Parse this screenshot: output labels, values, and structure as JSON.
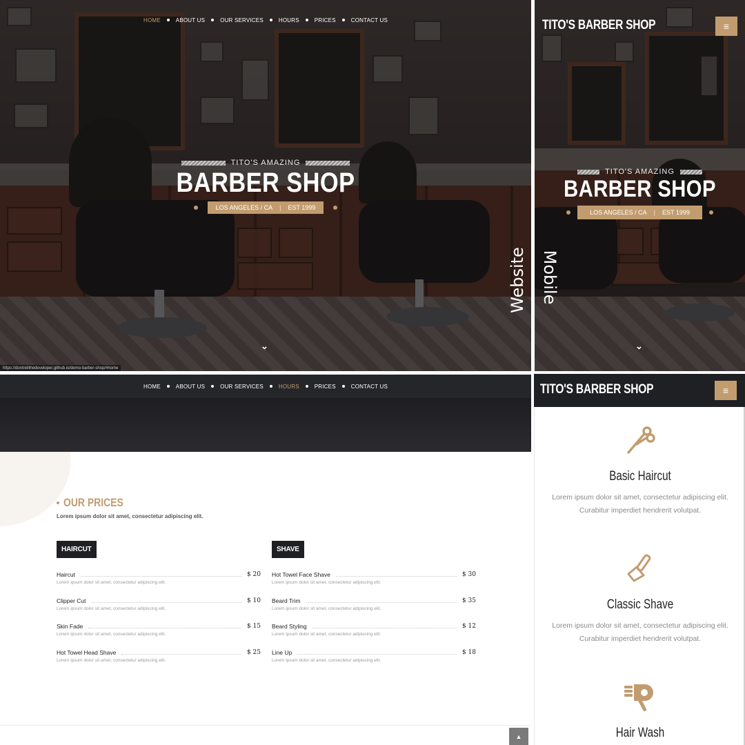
{
  "desktop": {
    "nav": [
      "HOME",
      "ABOUT US",
      "OUR SERVICES",
      "HOURS",
      "PRICES",
      "CONTACT US"
    ],
    "nav_active": "HOME",
    "hero_subtitle": "TITO'S AMAZING",
    "hero_title": "BARBER SHOP",
    "hero_location": "LOS ANGELES / CA",
    "hero_est": "EST 1999",
    "status_url": "https://dontrelithedeveloper.github.io/demo-barber-shop/#home"
  },
  "labels": {
    "website": "Website",
    "mobile": "Mobile"
  },
  "mobile": {
    "brand": "TITO'S BARBER SHOP",
    "menu_icon": "hamburger-icon",
    "hero_subtitle": "TITO'S AMAZING",
    "hero_title": "BARBER SHOP",
    "hero_location": "LOS ANGELES / CA",
    "hero_est": "EST 1999"
  },
  "prices_page": {
    "nav": [
      "HOME",
      "ABOUT US",
      "OUR SERVICES",
      "HOURS",
      "PRICES",
      "CONTACT US"
    ],
    "nav_active": "HOURS",
    "heading": "OUR PRICES",
    "subtitle": "Lorem ipsum dolor sit amet, consectetur adipiscing elit.",
    "categories": [
      {
        "name": "HAIRCUT",
        "items": [
          {
            "name": "Haircut",
            "price": "$ 20",
            "desc": "Lorem ipsum dolor sit amet, consectetur adipiscing elit."
          },
          {
            "name": "Clipper Cut",
            "price": "$ 10",
            "desc": "Lorem ipsum dolor sit amet, consectetur adipiscing elit."
          },
          {
            "name": "Skin Fade",
            "price": "$ 15",
            "desc": "Lorem ipsum dolor sit amet, consectetur adipiscing elit."
          },
          {
            "name": "Hot Towel Head Shave",
            "price": "$ 25",
            "desc": "Lorem ipsum dolor sit amet, consectetur adipiscing elit."
          }
        ]
      },
      {
        "name": "SHAVE",
        "items": [
          {
            "name": "Hot Towel Face Shave",
            "price": "$ 30",
            "desc": "Lorem ipsum dolor sit amet, consectetur adipiscing elit."
          },
          {
            "name": "Beard Trim",
            "price": "$ 35",
            "desc": "Lorem ipsum dolor sit amet, consectetur adipiscing elit."
          },
          {
            "name": "Beard Styling",
            "price": "$ 12",
            "desc": "Lorem ipsum dolor sit amet, consectetur adipiscing elit."
          },
          {
            "name": "Line Up",
            "price": "$ 18",
            "desc": "Lorem ipsum dolor sit amet, consectetur adipiscing elit."
          }
        ]
      }
    ],
    "back_to_top_icon": "caret-up-icon"
  },
  "mobile_services": {
    "brand": "TITO'S BARBER SHOP",
    "services": [
      {
        "icon": "scissors-icon",
        "title": "Basic Haircut",
        "text": "Lorem ipsum dolor sit amet, consectetur adipiscing elit. Curabitur imperdiet hendrerit volutpat."
      },
      {
        "icon": "razor-icon",
        "title": "Classic Shave",
        "text": "Lorem ipsum dolor sit amet, consectetur adipiscing elit. Curabitur imperdiet hendrerit volutpat."
      },
      {
        "icon": "hair-dryer-icon",
        "title": "Hair Wash",
        "text": ""
      }
    ]
  },
  "colors": {
    "accent": "#c29c6f",
    "dark": "#1f2024",
    "nav_bg": "#25262a"
  }
}
